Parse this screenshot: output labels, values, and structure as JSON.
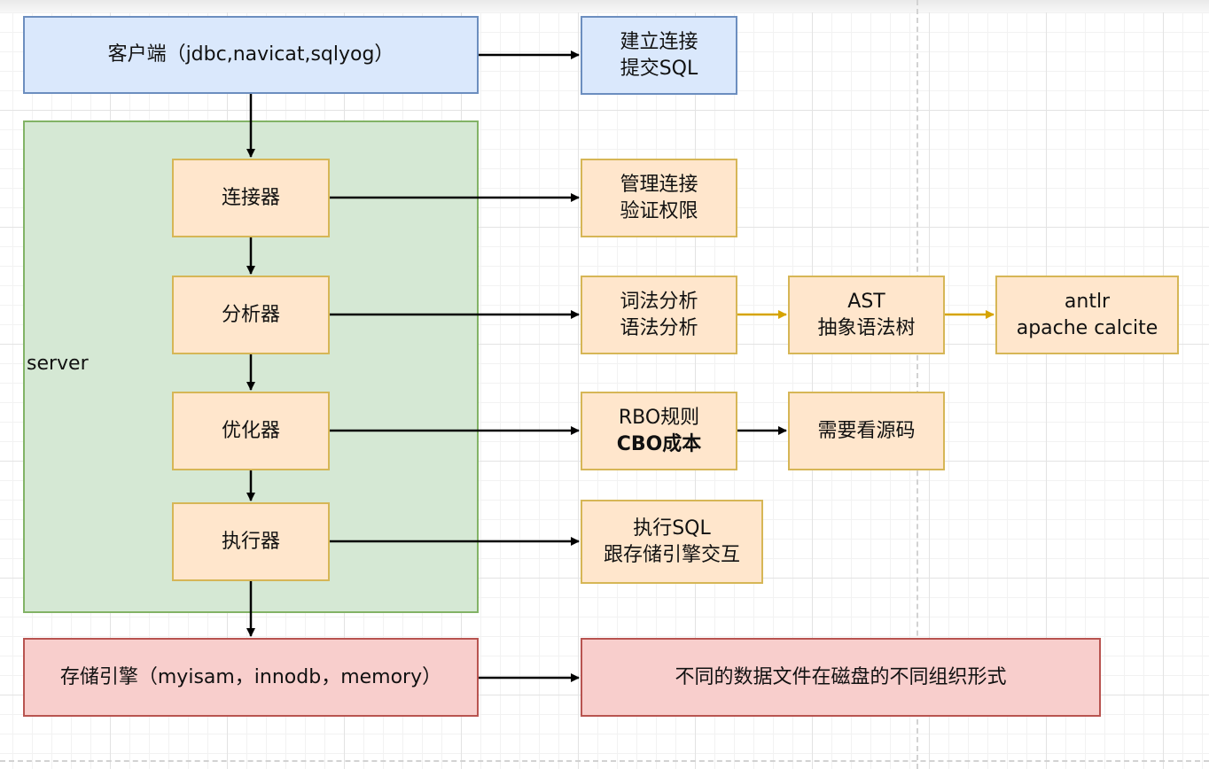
{
  "client": {
    "label": "客户端（jdbc,navicat,sqlyog）"
  },
  "client_note": {
    "line1": "建立连接",
    "line2": "提交SQL"
  },
  "server": {
    "label": "server"
  },
  "connector": {
    "label": "连接器",
    "note_line1": "管理连接",
    "note_line2": "验证权限"
  },
  "analyzer": {
    "label": "分析器",
    "note_line1": "词法分析",
    "note_line2": "语法分析",
    "ast_line1": "AST",
    "ast_line2": "抽象语法树",
    "tool_line1": "antlr",
    "tool_line2": "apache calcite"
  },
  "optimizer": {
    "label": "优化器",
    "note_line1": "RBO规则",
    "note_line2": "CBO成本",
    "source_note": "需要看源码"
  },
  "executor": {
    "label": "执行器",
    "note_line1": "执行SQL",
    "note_line2": "跟存储引擎交互"
  },
  "storage": {
    "label": "存储引擎（myisam，innodb，memory）",
    "note": "不同的数据文件在磁盘的不同组织形式"
  },
  "colors": {
    "blue_fill": "#dae8fc",
    "blue_stroke": "#6c8ebf",
    "orange_fill": "#ffe6cc",
    "orange_stroke": "#d6b656",
    "red_fill": "#f8cecc",
    "red_stroke": "#b85450",
    "green_fill": "#d5e8d4",
    "green_stroke": "#82b366",
    "edge_black": "#000000",
    "edge_gold": "#d6a400"
  }
}
